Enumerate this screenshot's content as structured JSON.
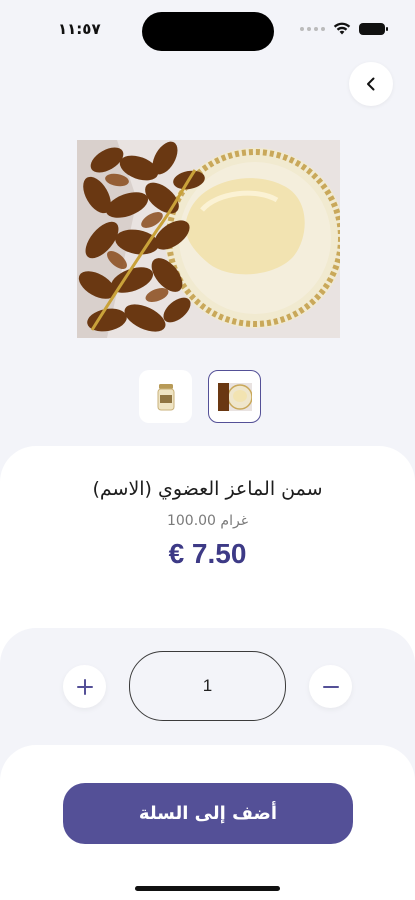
{
  "status_bar": {
    "time": "١١:٥٧",
    "icons": [
      "signal-dots-icon",
      "wifi-icon",
      "battery-icon"
    ]
  },
  "navigation": {
    "back_icon": "chevron-left-icon"
  },
  "product": {
    "name": "سمن الماعز العضوي (الاسم)",
    "weight": "100.00 غرام",
    "price": "€ 7.50",
    "images": [
      "main-image-dates-and-ghee",
      "thumb-jar",
      "thumb-dates-and-ghee"
    ],
    "selected_thumbnail": 2
  },
  "quantity": {
    "value": "1",
    "increment_icon": "plus-icon",
    "decrement_icon": "minus-icon"
  },
  "actions": {
    "add_to_cart_label": "أضف إلى السلة"
  },
  "colors": {
    "accent": "#545097",
    "price": "#3d3a86",
    "background": "#f3f4f9"
  }
}
